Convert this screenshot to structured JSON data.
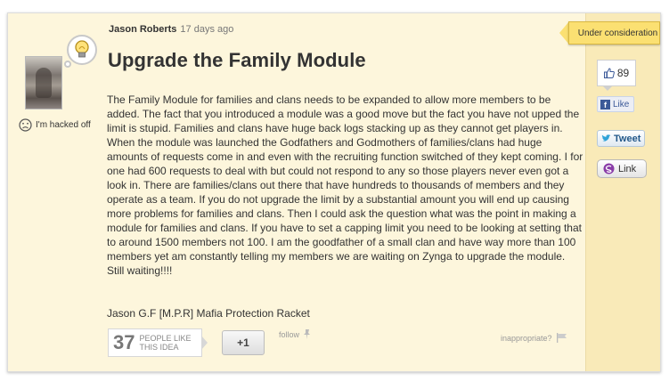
{
  "idea": {
    "author": "Jason Roberts",
    "time_ago": "17 days ago",
    "title": "Upgrade the Family Module",
    "body": "The Family Module for families and clans needs to be expanded to allow more members to be added. The fact that you introduced a module was a good move but the fact you have not upped the limit is stupid. Families and clans have huge back logs stacking up as they cannot get players in. When the module was launched the Godfathers and Godmothers of families/clans had huge amounts of requests come in and even with the recruiting function switched of they kept coming. I for one had 600 requests to deal with but could not respond to any so those players never even got a look in. There are families/clans out there that have hundreds to thousands of members and they operate as a team. If you do not upgrade the limit by a substantial amount you will end up causing more problems for families and clans. Then I could ask the question what was the point in making a module for families and clans. If you have to set a capping limit you need to be looking at setting that to around 1500 members not 100. I am the goodfather of a small clan and have way more than 100 members yet am constantly telling my members we are waiting on Zynga to upgrade the module. Still waiting!!!!",
    "signature": "Jason G.F [M.P.R] Mafia Protection Racket"
  },
  "user": {
    "mood_label": "I'm hacked off",
    "mood_icon": "frown-icon",
    "badge_icon": "lightbulb-icon"
  },
  "actions": {
    "like_count": "37",
    "like_label_line1": "PEOPLE LIKE",
    "like_label_line2": "THIS IDEA",
    "plus_one": "+1",
    "follow": "follow",
    "inappropriate": "inappropriate?"
  },
  "sidebar": {
    "status": "Under consideration",
    "votes": "89",
    "facebook_like": "Like",
    "tweet": "Tweet",
    "link": "Link"
  },
  "colors": {
    "card_background": "#fdf6dc",
    "sidebar_background": "#f9eab8",
    "status_tag": "#fbe072",
    "facebook_blue": "#3b5998"
  }
}
